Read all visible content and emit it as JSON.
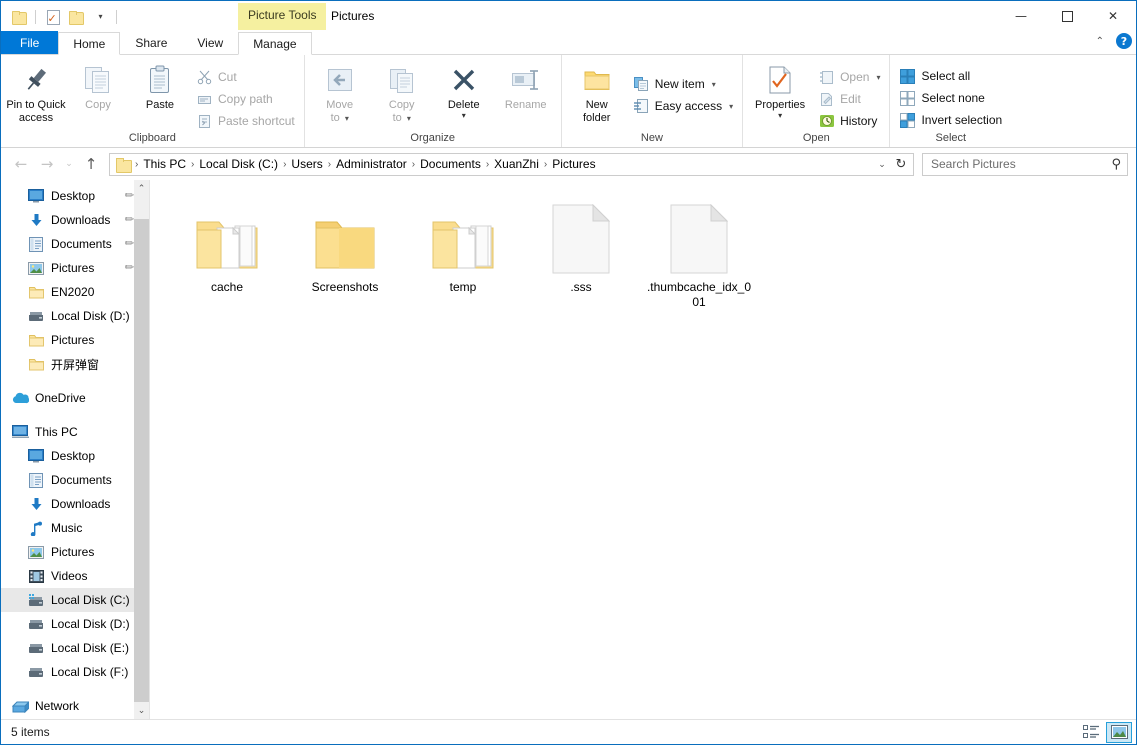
{
  "window": {
    "title": "Pictures",
    "contextual_tab": "Picture Tools",
    "minimize": "—",
    "maximize": "☐",
    "close": "✕",
    "collapse_ribbon": "⌃",
    "help": "?"
  },
  "quick_access": {
    "new_folder_icon": "folder-icon",
    "properties_icon": "properties-icon",
    "customize_icon": "customize-icon",
    "customize_caret": "▾"
  },
  "tabs": [
    {
      "label": "File",
      "id": "file"
    },
    {
      "label": "Home",
      "id": "home"
    },
    {
      "label": "Share",
      "id": "share"
    },
    {
      "label": "View",
      "id": "view"
    },
    {
      "label": "Manage",
      "id": "manage"
    }
  ],
  "ribbon": {
    "groups": [
      {
        "title": "Clipboard",
        "big_buttons": [
          {
            "label": "Pin to Quick\naccess",
            "line1": "Pin to Quick",
            "line2": "access",
            "icon": "pin-icon",
            "dim": false
          },
          {
            "label": "Copy",
            "icon": "copy-icon",
            "dim": true
          },
          {
            "label": "Paste",
            "icon": "paste-icon",
            "dim": false
          }
        ],
        "small_buttons": [
          {
            "label": "Cut",
            "icon": "scissors-icon",
            "dim": true
          },
          {
            "label": "Copy path",
            "icon": "copy-path-icon",
            "dim": true
          },
          {
            "label": "Paste shortcut",
            "icon": "paste-shortcut-icon",
            "dim": true
          }
        ]
      },
      {
        "title": "Organize",
        "big_buttons": [
          {
            "line1": "Move",
            "line2": "to",
            "icon": "move-to-icon",
            "dim": true,
            "caret": "▾"
          },
          {
            "line1": "Copy",
            "line2": "to",
            "icon": "copy-to-icon",
            "dim": true,
            "caret": "▾"
          },
          {
            "line1": "Delete",
            "line2": "",
            "icon": "delete-icon",
            "dim": false,
            "caret": "▾"
          },
          {
            "line1": "Rename",
            "line2": "",
            "icon": "rename-icon",
            "dim": true,
            "caret": ""
          }
        ],
        "small_buttons": []
      },
      {
        "title": "New",
        "big_buttons": [
          {
            "line1": "New",
            "line2": "folder",
            "icon": "new-folder-icon",
            "dim": false,
            "caret": ""
          }
        ],
        "small_buttons": [
          {
            "label": "New item",
            "icon": "new-item-icon",
            "dim": false,
            "caret": "▾"
          },
          {
            "label": "Easy access",
            "icon": "easy-access-icon",
            "dim": false,
            "caret": "▾"
          }
        ]
      },
      {
        "title": "Open",
        "big_buttons": [
          {
            "line1": "Properties",
            "line2": "",
            "icon": "properties-icon",
            "dim": false,
            "caret": "▾"
          }
        ],
        "small_buttons": [
          {
            "label": "Open",
            "icon": "open-icon",
            "dim": true,
            "caret": "▾"
          },
          {
            "label": "Edit",
            "icon": "edit-icon",
            "dim": true
          },
          {
            "label": "History",
            "icon": "history-icon",
            "dim": false
          }
        ]
      },
      {
        "title": "Select",
        "big_buttons": [],
        "small_buttons": [
          {
            "label": "Select all",
            "icon": "select-all-icon",
            "dim": false
          },
          {
            "label": "Select none",
            "icon": "select-none-icon",
            "dim": false
          },
          {
            "label": "Invert selection",
            "icon": "invert-selection-icon",
            "dim": false
          }
        ]
      }
    ]
  },
  "navigation": {
    "back": "←",
    "forward": "→",
    "recent": "⌄",
    "up": "↑",
    "breadcrumbs": [
      "This PC",
      "Local Disk (C:)",
      "Users",
      "Administrator",
      "Documents",
      "XuanZhi",
      "Pictures"
    ],
    "separator": "›",
    "dropdown_caret": "⌄",
    "refresh": "↻"
  },
  "search": {
    "placeholder": "Search Pictures",
    "value": "",
    "icon": "search-icon"
  },
  "sidebar": {
    "items": [
      {
        "label": "Desktop",
        "icon": "desktop-icon",
        "indent": 1,
        "pinned": true,
        "selected": false
      },
      {
        "label": "Downloads",
        "icon": "downloads-icon",
        "indent": 1,
        "pinned": true,
        "selected": false
      },
      {
        "label": "Documents",
        "icon": "documents-icon",
        "indent": 1,
        "pinned": true,
        "selected": false
      },
      {
        "label": "Pictures",
        "icon": "pictures-icon",
        "indent": 1,
        "pinned": true,
        "selected": false
      },
      {
        "label": "EN2020",
        "icon": "folder-icon",
        "indent": 1,
        "pinned": false,
        "selected": false
      },
      {
        "label": "Local Disk (D:)",
        "icon": "drive-icon",
        "indent": 1,
        "pinned": false,
        "selected": false
      },
      {
        "label": "Pictures",
        "icon": "folder-icon",
        "indent": 1,
        "pinned": false,
        "selected": false
      },
      {
        "label": "开屏弹窗",
        "icon": "folder-icon",
        "indent": 1,
        "pinned": false,
        "selected": false
      },
      {
        "label": "",
        "icon": "spacer",
        "indent": 0,
        "pinned": false,
        "selected": false,
        "spacer": true
      },
      {
        "label": "OneDrive",
        "icon": "onedrive-icon",
        "indent": 0,
        "pinned": false,
        "selected": false
      },
      {
        "label": "",
        "icon": "spacer",
        "indent": 0,
        "pinned": false,
        "selected": false,
        "spacer": true
      },
      {
        "label": "This PC",
        "icon": "thispc-icon",
        "indent": 0,
        "pinned": false,
        "selected": false
      },
      {
        "label": "Desktop",
        "icon": "desktop-icon",
        "indent": 1,
        "pinned": false,
        "selected": false
      },
      {
        "label": "Documents",
        "icon": "documents-icon",
        "indent": 1,
        "pinned": false,
        "selected": false
      },
      {
        "label": "Downloads",
        "icon": "downloads-icon",
        "indent": 1,
        "pinned": false,
        "selected": false
      },
      {
        "label": "Music",
        "icon": "music-icon",
        "indent": 1,
        "pinned": false,
        "selected": false
      },
      {
        "label": "Pictures",
        "icon": "pictures-icon",
        "indent": 1,
        "pinned": false,
        "selected": false
      },
      {
        "label": "Videos",
        "icon": "videos-icon",
        "indent": 1,
        "pinned": false,
        "selected": false
      },
      {
        "label": "Local Disk (C:)",
        "icon": "drive-c-icon",
        "indent": 1,
        "pinned": false,
        "selected": true
      },
      {
        "label": "Local Disk (D:)",
        "icon": "drive-icon",
        "indent": 1,
        "pinned": false,
        "selected": false
      },
      {
        "label": "Local Disk (E:)",
        "icon": "drive-icon",
        "indent": 1,
        "pinned": false,
        "selected": false
      },
      {
        "label": "Local Disk (F:)",
        "icon": "drive-icon",
        "indent": 1,
        "pinned": false,
        "selected": false
      },
      {
        "label": "",
        "icon": "spacer",
        "indent": 0,
        "pinned": false,
        "selected": false,
        "spacer": true
      },
      {
        "label": "Network",
        "icon": "network-icon",
        "indent": 0,
        "pinned": false,
        "selected": false
      }
    ],
    "pin_glyph": "✐",
    "scroll_up": "⌃",
    "scroll_down": "⌄"
  },
  "files": [
    {
      "name": "cache",
      "type": "folder-full",
      "icon": "folder-with-files-icon"
    },
    {
      "name": "Screenshots",
      "type": "folder-empty",
      "icon": "folder-icon"
    },
    {
      "name": "temp",
      "type": "folder-full",
      "icon": "folder-with-files-icon"
    },
    {
      "name": ".sss",
      "type": "file",
      "icon": "blank-file-icon"
    },
    {
      "name": ".thumbcache_idx_001",
      "type": "file",
      "icon": "blank-file-icon"
    }
  ],
  "status": {
    "item_count": "5 items",
    "details_view_icon": "details-view-icon",
    "large_icons_view_icon": "large-icons-view-icon",
    "active_view": "large-icons"
  },
  "colors": {
    "accent": "#0078d7",
    "contextual_tab": "#f5f0a0",
    "selection": "#cce8f6",
    "folder": "#fce5a0",
    "window_border": "#0a6ebd"
  }
}
